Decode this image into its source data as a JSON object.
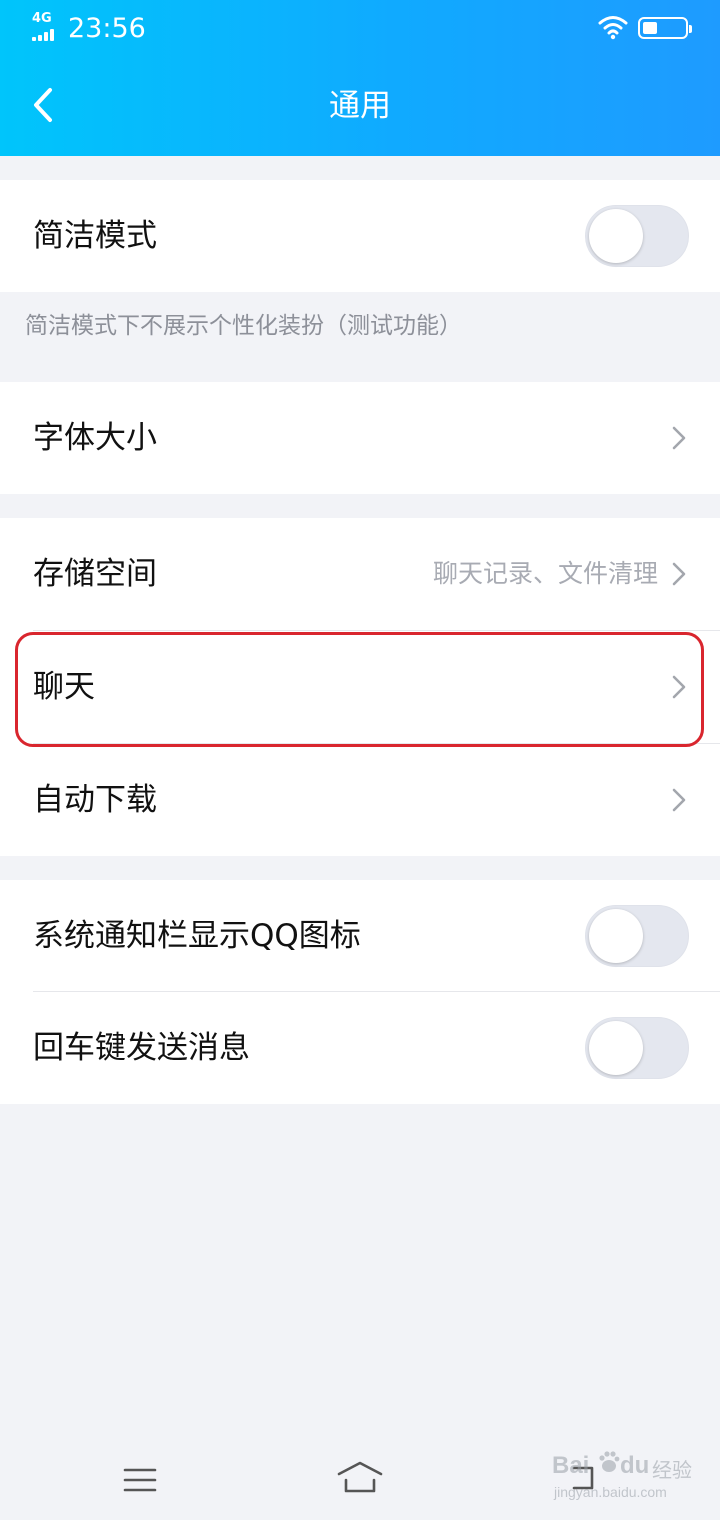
{
  "status_bar": {
    "network": "4G",
    "time": "23:56"
  },
  "header": {
    "title": "通用",
    "back_icon": "chevron-left-icon"
  },
  "groups": [
    {
      "rows": [
        {
          "label": "简洁模式",
          "control": "toggle",
          "on": false
        }
      ],
      "note": "简洁模式下不展示个性化装扮（测试功能）"
    },
    {
      "rows": [
        {
          "label": "字体大小",
          "control": "chevron"
        }
      ]
    },
    {
      "rows": [
        {
          "label": "存储空间",
          "detail": "聊天记录、文件清理",
          "control": "chevron"
        },
        {
          "label": "聊天",
          "control": "chevron",
          "highlighted": true
        },
        {
          "label": "自动下载",
          "control": "chevron"
        }
      ]
    },
    {
      "rows": [
        {
          "label": "系统通知栏显示QQ图标",
          "control": "toggle",
          "on": false
        },
        {
          "label": "回车键发送消息",
          "control": "toggle",
          "on": false
        }
      ]
    }
  ],
  "highlight_color": "#d9262e",
  "nav_bar": {
    "icons": [
      "menu-icon",
      "home-icon",
      "back-icon"
    ]
  },
  "watermark": {
    "brand": "Bai",
    "brand_suffix": "du",
    "product": "经验",
    "url": "jingyan.baidu.com"
  }
}
